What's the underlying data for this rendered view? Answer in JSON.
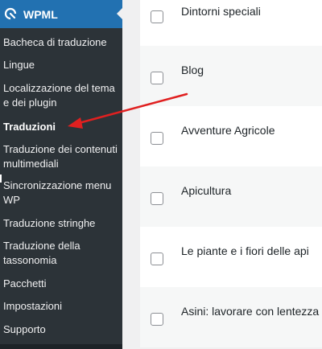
{
  "menu": {
    "title": "WPML",
    "items": [
      {
        "label": "Bacheca di traduzione",
        "current": false
      },
      {
        "label": "Lingue",
        "current": false
      },
      {
        "label": "Localizzazione del tema e dei plugin",
        "current": false
      },
      {
        "label": "Traduzioni",
        "current": true
      },
      {
        "label": "Traduzione dei contenuti multimediali",
        "current": false
      },
      {
        "label": "Sincronizzazione menu WP",
        "current": false
      },
      {
        "label": "Traduzione stringhe",
        "current": false
      },
      {
        "label": "Traduzione della tassonomia",
        "current": false
      },
      {
        "label": "Pacchetti",
        "current": false
      },
      {
        "label": "Impostazioni",
        "current": false
      },
      {
        "label": "Supporto",
        "current": false
      }
    ]
  },
  "rows": [
    {
      "title": "Dintorni speciali"
    },
    {
      "title": "Blog"
    },
    {
      "title": "Avventure Agricole"
    },
    {
      "title": "Apicultura"
    },
    {
      "title": "Le piante e i fiori delle api"
    },
    {
      "title": "Asini: lavorare con lentezza"
    }
  ],
  "colors": {
    "sidebar_bg": "#2c3338",
    "menu_head_bg": "#2271b1",
    "annotation_arrow": "#e02020"
  }
}
